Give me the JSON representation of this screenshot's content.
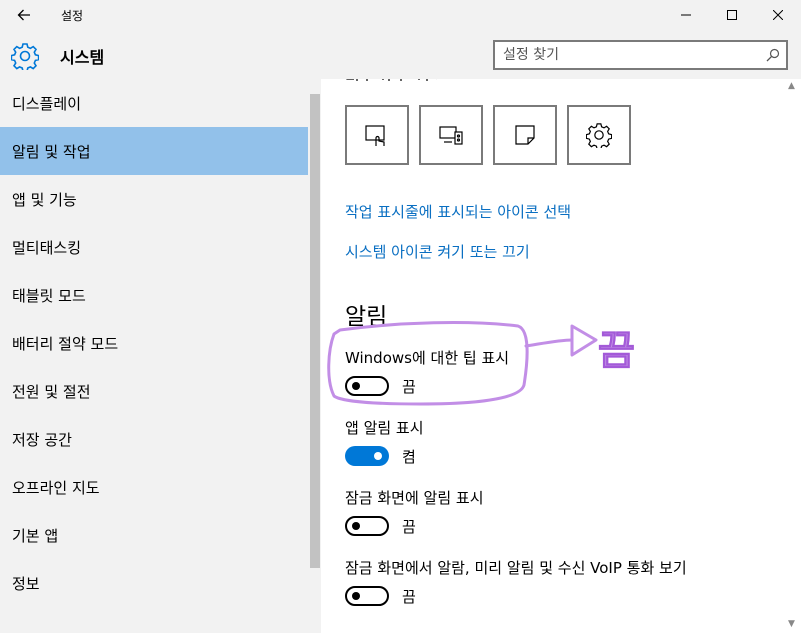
{
  "window": {
    "title": "설정"
  },
  "header": {
    "title": "시스템",
    "search_placeholder": "설정 찾기"
  },
  "sidebar": {
    "items": [
      {
        "label": "디스플레이",
        "active": false
      },
      {
        "label": "알림 및 작업",
        "active": true
      },
      {
        "label": "앱 및 기능",
        "active": false
      },
      {
        "label": "멀티태스킹",
        "active": false
      },
      {
        "label": "태블릿 모드",
        "active": false
      },
      {
        "label": "배터리 절약 모드",
        "active": false
      },
      {
        "label": "전원 및 절전",
        "active": false
      },
      {
        "label": "저장 공간",
        "active": false
      },
      {
        "label": "오프라인 지도",
        "active": false
      },
      {
        "label": "기본 앱",
        "active": false
      },
      {
        "label": "정보",
        "active": false
      }
    ]
  },
  "content": {
    "quick_actions": [
      {
        "icon": "tablet-mode-icon"
      },
      {
        "icon": "project-icon"
      },
      {
        "icon": "note-icon"
      },
      {
        "icon": "settings-gear-icon"
      }
    ],
    "links": {
      "taskbar_icons": "작업 표시줄에 표시되는 아이콘 선택",
      "system_icons": "시스템 아이콘 켜기 또는 끄기"
    },
    "notifications_heading": "알림",
    "options": [
      {
        "label": "Windows에 대한 팁 표시",
        "state": "끔",
        "on": false
      },
      {
        "label": "앱 알림 표시",
        "state": "켬",
        "on": true
      },
      {
        "label": "잠금 화면에 알림 표시",
        "state": "끔",
        "on": false
      },
      {
        "label": "잠금 화면에서 알람, 미리 알림 및 수신 VoIP 통화 보기",
        "state": "끔",
        "on": false
      }
    ]
  },
  "annotation": {
    "text": "끔"
  },
  "colors": {
    "accent": "#0078d7",
    "link": "#0a6fc2",
    "active_item": "#92c1ea",
    "annotation": "#c28ee6"
  }
}
